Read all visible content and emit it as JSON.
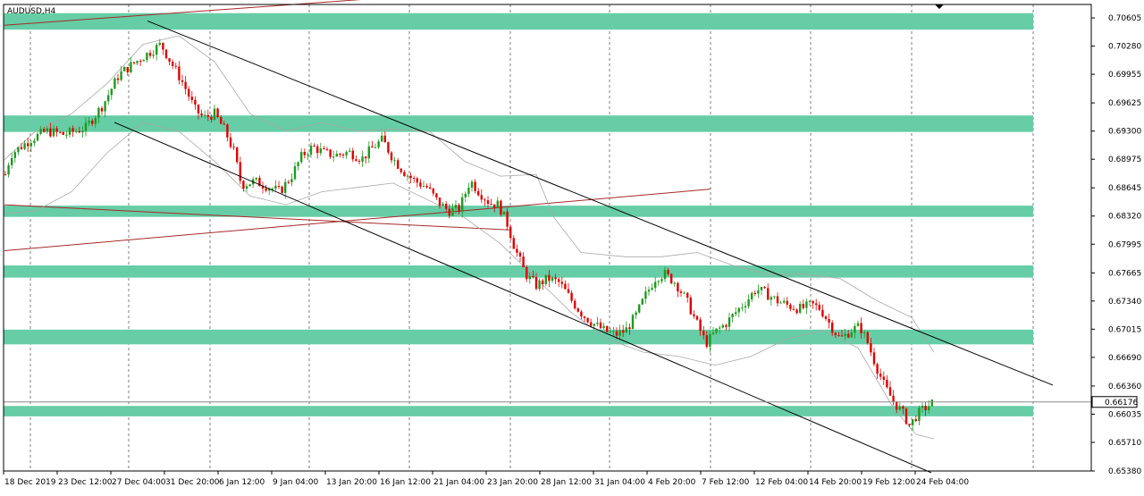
{
  "window": {
    "title": "AUDUSD,H4"
  },
  "colors": {
    "background": "#ffffff",
    "grid": "#7f7f7f",
    "zone": "#66cda6",
    "bull": "#1f9a1f",
    "bear": "#e00000",
    "channel": "#000000",
    "envelope": "#a8a8a8",
    "trend_red": "#a52a2a",
    "price_line": "#8c8c8c",
    "text": "#000000"
  },
  "chart_data": {
    "type": "candlestick",
    "symbol": "AUDUSD",
    "timeframe": "H4",
    "ylim": [
      0.6538,
      0.7076
    ],
    "current_price": "0.66176",
    "y_ticks": [
      "0.70605",
      "0.70280",
      "0.69955",
      "0.69625",
      "0.69300",
      "0.68975",
      "0.68645",
      "0.68320",
      "0.67995",
      "0.67665",
      "0.67340",
      "0.67015",
      "0.66690",
      "0.66360",
      "0.66035",
      "0.65710",
      "0.65380"
    ],
    "x_ticks": [
      "18 Dec 2019",
      "23 Dec 12:00",
      "27 Dec 04:00",
      "31 Dec 20:00",
      "6 Jan 12:00",
      "9 Jan 04:00",
      "13 Jan 20:00",
      "16 Jan 12:00",
      "21 Jan 04:00",
      "23 Jan 20:00",
      "28 Jan 12:00",
      "31 Jan 04:00",
      "4 Feb 20:00",
      "7 Feb 12:00",
      "12 Feb 04:00",
      "14 Feb 20:00",
      "19 Feb 12:00",
      "24 Feb 04:00"
    ],
    "zones": [
      {
        "low": 0.7047,
        "high": 0.7066
      },
      {
        "low": 0.6929,
        "high": 0.6948
      },
      {
        "low": 0.6831,
        "high": 0.6844
      },
      {
        "low": 0.6761,
        "high": 0.6775
      },
      {
        "low": 0.6684,
        "high": 0.6701
      },
      {
        "low": 0.6601,
        "high": 0.6613
      }
    ],
    "price_path": [
      [
        0,
        0.6857
      ],
      [
        12,
        0.6903
      ],
      [
        35,
        0.6921
      ],
      [
        52,
        0.693
      ],
      [
        72,
        0.6926
      ],
      [
        96,
        0.6934
      ],
      [
        115,
        0.696
      ],
      [
        133,
        0.6995
      ],
      [
        152,
        0.701
      ],
      [
        166,
        0.702
      ],
      [
        180,
        0.703
      ],
      [
        192,
        0.7008
      ],
      [
        205,
        0.6985
      ],
      [
        218,
        0.6955
      ],
      [
        228,
        0.6945
      ],
      [
        240,
        0.695
      ],
      [
        252,
        0.693
      ],
      [
        262,
        0.6905
      ],
      [
        270,
        0.6868
      ],
      [
        285,
        0.6872
      ],
      [
        300,
        0.6866
      ],
      [
        313,
        0.686
      ],
      [
        326,
        0.6878
      ],
      [
        338,
        0.6902
      ],
      [
        350,
        0.6912
      ],
      [
        362,
        0.6905
      ],
      [
        375,
        0.6902
      ],
      [
        390,
        0.6906
      ],
      [
        405,
        0.6898
      ],
      [
        418,
        0.6912
      ],
      [
        428,
        0.692
      ],
      [
        440,
        0.6898
      ],
      [
        452,
        0.6883
      ],
      [
        465,
        0.6872
      ],
      [
        478,
        0.6865
      ],
      [
        490,
        0.6848
      ],
      [
        502,
        0.6838
      ],
      [
        514,
        0.684
      ],
      [
        526,
        0.6873
      ],
      [
        536,
        0.686
      ],
      [
        548,
        0.6847
      ],
      [
        558,
        0.6845
      ],
      [
        568,
        0.6822
      ],
      [
        576,
        0.6795
      ],
      [
        588,
        0.6765
      ],
      [
        600,
        0.6752
      ],
      [
        613,
        0.676
      ],
      [
        626,
        0.6755
      ],
      [
        640,
        0.6734
      ],
      [
        652,
        0.6718
      ],
      [
        664,
        0.6708
      ],
      [
        676,
        0.67
      ],
      [
        688,
        0.6695
      ],
      [
        700,
        0.67
      ],
      [
        712,
        0.6718
      ],
      [
        722,
        0.674
      ],
      [
        734,
        0.6762
      ],
      [
        744,
        0.6765
      ],
      [
        756,
        0.6755
      ],
      [
        768,
        0.6735
      ],
      [
        778,
        0.6712
      ],
      [
        790,
        0.6685
      ],
      [
        800,
        0.6698
      ],
      [
        812,
        0.6708
      ],
      [
        824,
        0.6722
      ],
      [
        836,
        0.6735
      ],
      [
        846,
        0.6748
      ],
      [
        858,
        0.6742
      ],
      [
        870,
        0.6734
      ],
      [
        884,
        0.6728
      ],
      [
        896,
        0.6725
      ],
      [
        908,
        0.673
      ],
      [
        918,
        0.6725
      ],
      [
        930,
        0.6705
      ],
      [
        940,
        0.669
      ],
      [
        952,
        0.67
      ],
      [
        962,
        0.6705
      ],
      [
        970,
        0.6688
      ],
      [
        980,
        0.666
      ],
      [
        990,
        0.6635
      ],
      [
        1000,
        0.6618
      ],
      [
        1010,
        0.6605
      ],
      [
        1018,
        0.659
      ],
      [
        1026,
        0.6603
      ],
      [
        1034,
        0.661
      ],
      [
        1044,
        0.6617
      ]
    ],
    "channel_upper": [
      [
        165,
        0.7057
      ],
      [
        1178,
        0.6637
      ]
    ],
    "channel_lower": [
      [
        128,
        0.694
      ],
      [
        1042,
        0.6536
      ]
    ],
    "trend_lines": [
      [
        [
          5,
          0.7052
        ],
        [
          570,
          0.7094
        ]
      ],
      [
        [
          5,
          0.6845
        ],
        [
          570,
          0.6816
        ]
      ],
      [
        [
          5,
          0.6792
        ],
        [
          795,
          0.6863
        ]
      ]
    ],
    "envelope_upper": [
      [
        5,
        0.6897
      ],
      [
        40,
        0.693
      ],
      [
        80,
        0.695
      ],
      [
        120,
        0.6985
      ],
      [
        160,
        0.703
      ],
      [
        200,
        0.704
      ],
      [
        240,
        0.701
      ],
      [
        280,
        0.695
      ],
      [
        320,
        0.693
      ],
      [
        360,
        0.694
      ],
      [
        400,
        0.693
      ],
      [
        440,
        0.6932
      ],
      [
        480,
        0.693
      ],
      [
        520,
        0.6895
      ],
      [
        560,
        0.6878
      ],
      [
        600,
        0.688
      ],
      [
        620,
        0.683
      ],
      [
        650,
        0.679
      ],
      [
        700,
        0.6785
      ],
      [
        740,
        0.6785
      ],
      [
        780,
        0.679
      ],
      [
        820,
        0.6775
      ],
      [
        860,
        0.6765
      ],
      [
        900,
        0.6765
      ],
      [
        940,
        0.676
      ],
      [
        980,
        0.6735
      ],
      [
        1020,
        0.6715
      ],
      [
        1045,
        0.6675
      ]
    ],
    "envelope_lower": [
      [
        5,
        0.6835
      ],
      [
        40,
        0.6838
      ],
      [
        80,
        0.686
      ],
      [
        120,
        0.6905
      ],
      [
        160,
        0.694
      ],
      [
        200,
        0.693
      ],
      [
        240,
        0.6895
      ],
      [
        280,
        0.6855
      ],
      [
        320,
        0.6845
      ],
      [
        360,
        0.686
      ],
      [
        400,
        0.6865
      ],
      [
        440,
        0.687
      ],
      [
        480,
        0.685
      ],
      [
        520,
        0.683
      ],
      [
        560,
        0.68
      ],
      [
        600,
        0.676
      ],
      [
        640,
        0.672
      ],
      [
        680,
        0.669
      ],
      [
        720,
        0.6675
      ],
      [
        760,
        0.667
      ],
      [
        800,
        0.666
      ],
      [
        840,
        0.667
      ],
      [
        880,
        0.669
      ],
      [
        920,
        0.67
      ],
      [
        960,
        0.668
      ],
      [
        1000,
        0.661
      ],
      [
        1025,
        0.658
      ],
      [
        1045,
        0.6575
      ]
    ]
  }
}
